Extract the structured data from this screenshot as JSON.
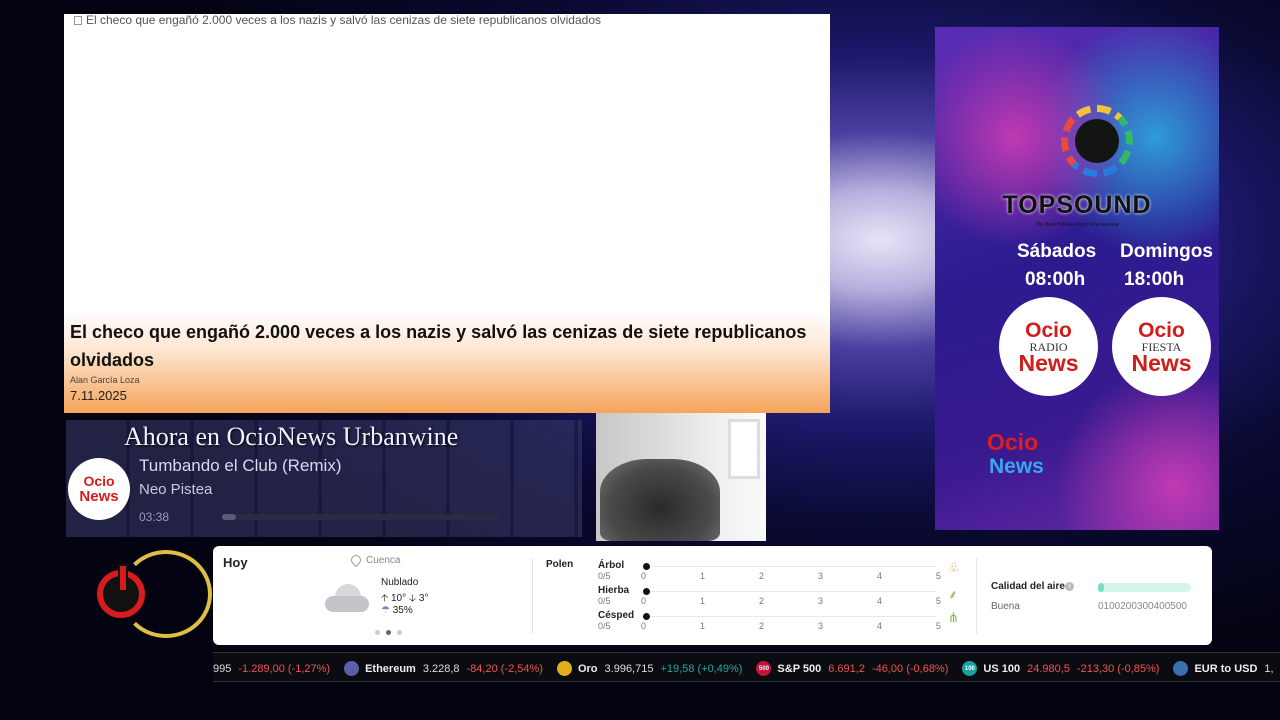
{
  "news": {
    "image_alt": "El checo que engañó 2.000 veces a los nazis y salvó las cenizas de siete republicanos olvidados",
    "title": "El checo que engañó 2.000 veces a los nazis y salvó las cenizas de siete republicanos olvidados",
    "author": "Alan García Loza",
    "date": "7.11.2025"
  },
  "player": {
    "headline": "Ahora en OcioNews Urbanwine",
    "song": "Tumbando el Club (Remix)",
    "artist": "Neo Pistea",
    "time": "03:38",
    "logo_top": "Ocio",
    "logo_bottom": "News",
    "progress_fraction": 0.05
  },
  "banner": {
    "brand": "TOPSOUND",
    "tagline": "The Best Holiday Music From Europe",
    "day1": "Sábados",
    "day2": "Domingos",
    "time1": "08:00h",
    "time2": "18:00h",
    "logo1": {
      "top": "Ocio",
      "mid": "RADIO",
      "bottom": "News"
    },
    "logo2": {
      "top": "Ocio",
      "mid": "FIESTA",
      "bottom": "News"
    },
    "small_top": "Ocio",
    "small_bottom": "News"
  },
  "weather": {
    "today": "Hoy",
    "city": "Cuenca",
    "condition": "Nublado",
    "high": "10°",
    "low": "3°",
    "rain": "35%",
    "pollen_label": "Polen",
    "pollen": [
      {
        "name": "Árbol",
        "score": "0/5",
        "value": 0,
        "icon": "tree-icon"
      },
      {
        "name": "Hierba",
        "score": "0/5",
        "value": 0,
        "icon": "grass-icon"
      },
      {
        "name": "Césped",
        "score": "0/5",
        "value": 0,
        "icon": "lawn-icon"
      }
    ],
    "ticks": [
      "0",
      "1",
      "2",
      "3",
      "4",
      "5"
    ],
    "air_label": "Calidad del aire",
    "air_status": "Buena",
    "air_scale": "0100200300400500"
  },
  "ticker": [
    {
      "name": "",
      "price": "995",
      "change": "-1.289,00 (-1,27%)",
      "dir": "neg",
      "icon": "",
      "color": ""
    },
    {
      "name": "Ethereum",
      "price": "3.228,8",
      "change": "-84,20 (-2,54%)",
      "dir": "neg",
      "icon": "ethereum-icon",
      "color": "#5c5fa8"
    },
    {
      "name": "Oro",
      "price": "3.996,715",
      "change": "+19,58 (+0,49%)",
      "dir": "pos",
      "icon": "gold-icon",
      "color": "#e0b018"
    },
    {
      "name": "S&P 500",
      "price": "6.691,2",
      "change": "-46,00 (-0,68%)",
      "dir": "neg",
      "icon": "sp500-icon",
      "color": "#c0143c",
      "badge": "500",
      "price_color": "red"
    },
    {
      "name": "US 100",
      "price": "24.980,5",
      "change": "-213,30 (-0,85%)",
      "dir": "neg",
      "icon": "us100-icon",
      "color": "#1aa3a3",
      "badge": "100",
      "price_color": "red"
    },
    {
      "name": "EUR to USD",
      "price": "1,",
      "change": "",
      "dir": "neg",
      "icon": "eurusd-icon",
      "color": "#3a6fb0"
    }
  ]
}
